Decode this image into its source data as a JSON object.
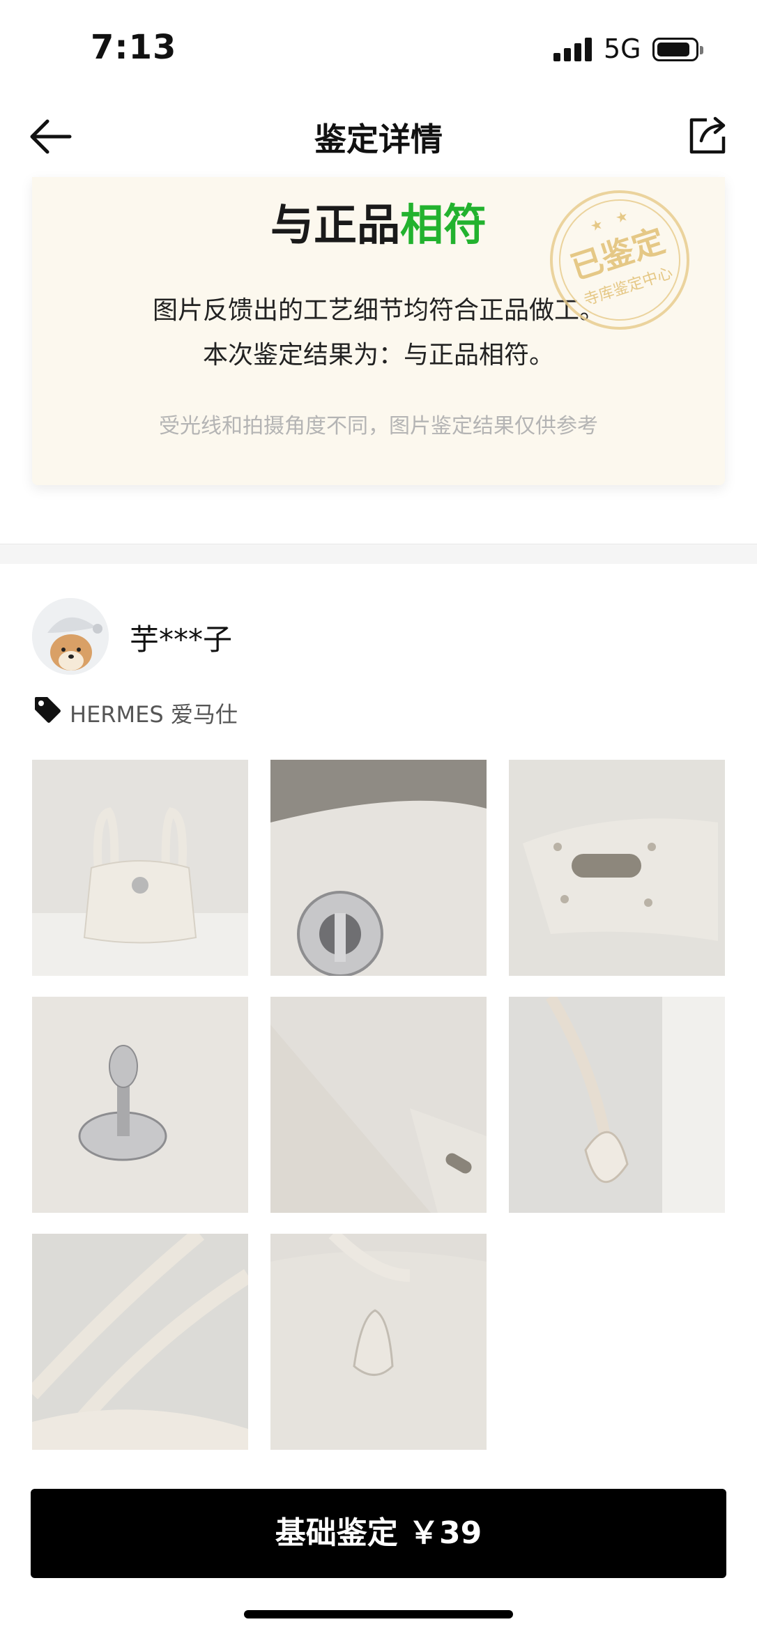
{
  "status_bar": {
    "time": "7:13",
    "network": "5G"
  },
  "nav": {
    "title": "鉴定详情"
  },
  "result": {
    "verdict_prefix": "与正品",
    "verdict_highlight": "相符",
    "description_line1": "图片反馈出的工艺细节均符合正品做工。",
    "description_line2": "本次鉴定结果为：与正品相符。",
    "disclaimer": "受光线和拍摄角度不同，图片鉴定结果仅供参考",
    "stamp_main": "已鉴定",
    "stamp_sub": "寺库鉴定中心"
  },
  "user": {
    "name": "芋***子"
  },
  "brand": {
    "label": "HERMES 爱马仕"
  },
  "photos": [
    {
      "icon": "bag-front-photo"
    },
    {
      "icon": "lock-closeup-photo"
    },
    {
      "icon": "strap-tab-photo"
    },
    {
      "icon": "turn-lock-photo"
    },
    {
      "icon": "stamp-leather-photo"
    },
    {
      "icon": "handle-photo"
    },
    {
      "icon": "handles-top-photo"
    },
    {
      "icon": "side-tab-photo"
    }
  ],
  "cta": {
    "label": "基础鉴定 ￥39"
  },
  "colors": {
    "accent_green": "#22b22e",
    "card_bg": "#fcf8ee",
    "stamp": "#e3c27a"
  }
}
